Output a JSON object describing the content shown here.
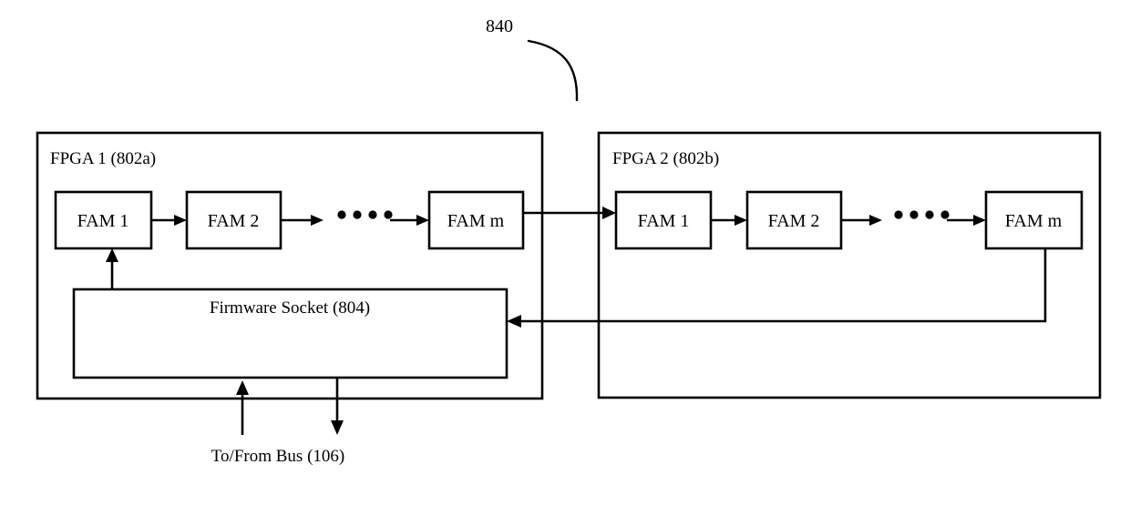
{
  "figure": {
    "reference_numeral": "840",
    "type": "patent-block-diagram"
  },
  "fpga1": {
    "title": "FPGA 1 (802a)",
    "modules": [
      {
        "label": "FAM 1"
      },
      {
        "label": "FAM 2"
      },
      {
        "label": "FAM m"
      }
    ],
    "ellipsis": "• • • •",
    "firmware_socket": {
      "label": "Firmware Socket (804)"
    }
  },
  "fpga2": {
    "title": "FPGA 2 (802b)",
    "modules": [
      {
        "label": "FAM 1"
      },
      {
        "label": "FAM 2"
      },
      {
        "label": "FAM m"
      }
    ],
    "ellipsis": "• • • •"
  },
  "bus": {
    "label": "To/From Bus (106)"
  },
  "colors": {
    "stroke": "#000000",
    "fill": "#ffffff",
    "background": "#ffffff"
  }
}
